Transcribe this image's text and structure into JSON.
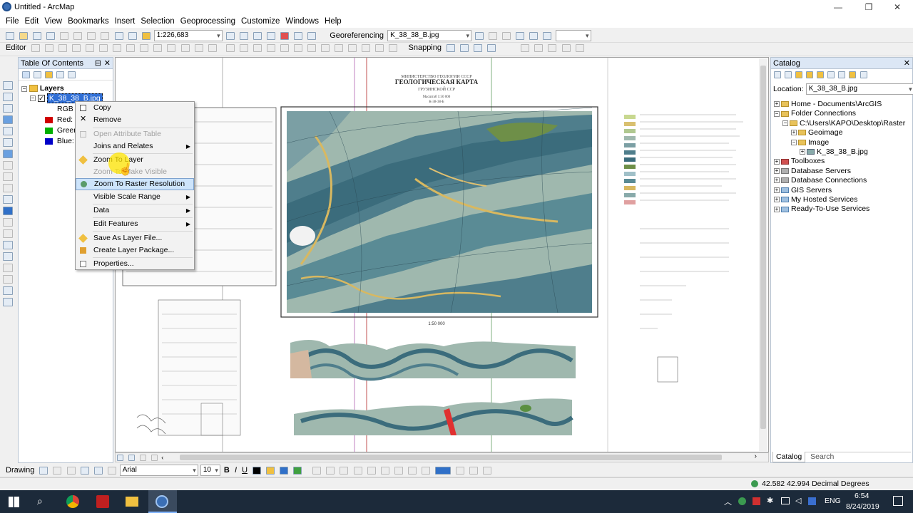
{
  "window": {
    "title": "Untitled - ArcMap",
    "minimize": "—",
    "maximize": "❐",
    "close": "✕"
  },
  "menu": [
    "File",
    "Edit",
    "View",
    "Bookmarks",
    "Insert",
    "Selection",
    "Geoprocessing",
    "Customize",
    "Windows",
    "Help"
  ],
  "toolbar": {
    "scale": "1:226,683",
    "georef_label": "Georeferencing",
    "georef_layer": "K_38_38_B.jpg",
    "editor": "Editor",
    "snapping": "Snapping",
    "drawing": "Drawing",
    "font": "Arial",
    "font_size": "10"
  },
  "toc": {
    "title": "Table Of Contents",
    "close": "✕",
    "pin": "⊟",
    "layers_root": "Layers",
    "layer_name": "K_38_38_B.jpg",
    "rgb": "RGB",
    "bands": [
      {
        "label": "Red:",
        "color": "#d00000"
      },
      {
        "label": "Green:",
        "color": "#00b000"
      },
      {
        "label": "Blue:",
        "color": "#0000c8"
      }
    ]
  },
  "context_menu": {
    "items": [
      {
        "label": "Copy",
        "icon": "copy-icon"
      },
      {
        "label": "Remove",
        "icon": "remove-icon"
      },
      {
        "label": "Open Attribute Table",
        "disabled": true
      },
      {
        "label": "Joins and Relates",
        "submenu": true
      },
      {
        "label": "Zoom To Layer",
        "icon": "zoom-layer-icon"
      },
      {
        "label": "Zoom To Make Visible",
        "disabled": true
      },
      {
        "label": "Zoom To Raster Resolution",
        "highlighted": true,
        "icon": "raster-resolution-icon"
      },
      {
        "label": "Visible Scale Range",
        "submenu": true
      },
      {
        "label": "Data",
        "submenu": true
      },
      {
        "label": "Edit Features",
        "submenu": true
      },
      {
        "label": "Save As Layer File...",
        "icon": "layer-file-icon"
      },
      {
        "label": "Create Layer Package...",
        "icon": "layer-package-icon"
      },
      {
        "label": "Properties...",
        "icon": "properties-icon"
      }
    ]
  },
  "map": {
    "title_ru": "ГЕОЛОГИЧЕСКАЯ КАРТА",
    "subtitle_ru": "ГРУЗИНСКОЙ ССР",
    "org_ru": "МИНИСТЕРСТВО ГЕОЛОГИИ СССР",
    "scale_text": "Масштаб 1:50 000",
    "sheet": "К-38-38-Б"
  },
  "catalog": {
    "title": "Catalog",
    "close": "✕",
    "location_label": "Location:",
    "location_value": "K_38_38_B.jpg",
    "tree": [
      {
        "label": "Home - Documents\\ArcGIS",
        "level": 0,
        "expander": "+"
      },
      {
        "label": "Folder Connections",
        "level": 0,
        "expander": "−"
      },
      {
        "label": "C:\\Users\\KAPO\\Desktop\\Raster",
        "level": 1,
        "expander": "−"
      },
      {
        "label": "Geoimage",
        "level": 2,
        "expander": "+"
      },
      {
        "label": "Image",
        "level": 2,
        "expander": "−"
      },
      {
        "label": "K_38_38_B.jpg",
        "level": 3,
        "expander": "+"
      },
      {
        "label": "Toolboxes",
        "level": 0,
        "expander": "+"
      },
      {
        "label": "Database Servers",
        "level": 0,
        "expander": "+"
      },
      {
        "label": "Database Connections",
        "level": 0,
        "expander": "+"
      },
      {
        "label": "GIS Servers",
        "level": 0,
        "expander": "+"
      },
      {
        "label": "My Hosted Services",
        "level": 0,
        "expander": "+"
      },
      {
        "label": "Ready-To-Use Services",
        "level": 0,
        "expander": "+"
      }
    ],
    "tab_catalog": "Catalog",
    "tab_search": "Search"
  },
  "status": {
    "coords": "42.582  42.994 Decimal Degrees"
  },
  "taskbar": {
    "lang": "ENG",
    "time": "6:54",
    "date": "8/24/2019"
  }
}
